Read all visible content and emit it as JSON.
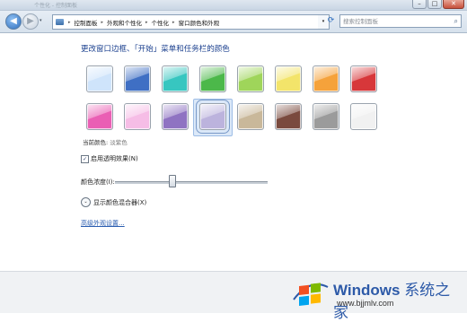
{
  "window": {
    "title": "个性化 - 控制面板"
  },
  "nav": {
    "back": "◀",
    "forward": "▶",
    "history": "▾"
  },
  "address": {
    "crumbs": [
      "控制面板",
      "外观和个性化",
      "个性化",
      "窗口颜色和外观"
    ],
    "separator": "▸"
  },
  "search": {
    "placeholder": "搜索控制面板"
  },
  "main": {
    "heading": "更改窗口边框、「开始」菜单和任务栏的颜色",
    "current_color_label": "当前颜色:",
    "current_color_value": "淡紫色",
    "transparency_label": "启用透明效果(N)",
    "intensity_label": "颜色浓度(I):",
    "intensity_value": 0.37,
    "mixer_label": "显示颜色混合器(X)",
    "advanced_link": "高级外观设置..."
  },
  "swatches": {
    "row1": [
      {
        "name": "sky",
        "color": "#cfe4fb"
      },
      {
        "name": "twilight",
        "color": "#3f6fc4"
      },
      {
        "name": "sea",
        "color": "#37c6c0"
      },
      {
        "name": "leaf",
        "color": "#4cb84a"
      },
      {
        "name": "lime",
        "color": "#9fd55a"
      },
      {
        "name": "lemon",
        "color": "#f3e46a"
      },
      {
        "name": "orange",
        "color": "#f5a23b"
      },
      {
        "name": "ruby",
        "color": "#d7373a"
      }
    ],
    "row2": [
      {
        "name": "fuchsia",
        "color": "#ea5fb4"
      },
      {
        "name": "blush",
        "color": "#f6bde6"
      },
      {
        "name": "violet",
        "color": "#8f73c2"
      },
      {
        "name": "lavender",
        "color": "#bcb3dd"
      },
      {
        "name": "taupe",
        "color": "#c9b89a"
      },
      {
        "name": "chocolate",
        "color": "#7a4a3e"
      },
      {
        "name": "slate",
        "color": "#9b9b9b"
      },
      {
        "name": "frost",
        "color": "#f1f1f1"
      }
    ],
    "selected": "lavender"
  },
  "watermark": {
    "brand": "Windows",
    "brand_cn": "系统之家",
    "url": "www.bjjmlv.com",
    "logo_colors": [
      "#f25022",
      "#7fba00",
      "#00a4ef",
      "#ffb900"
    ]
  }
}
